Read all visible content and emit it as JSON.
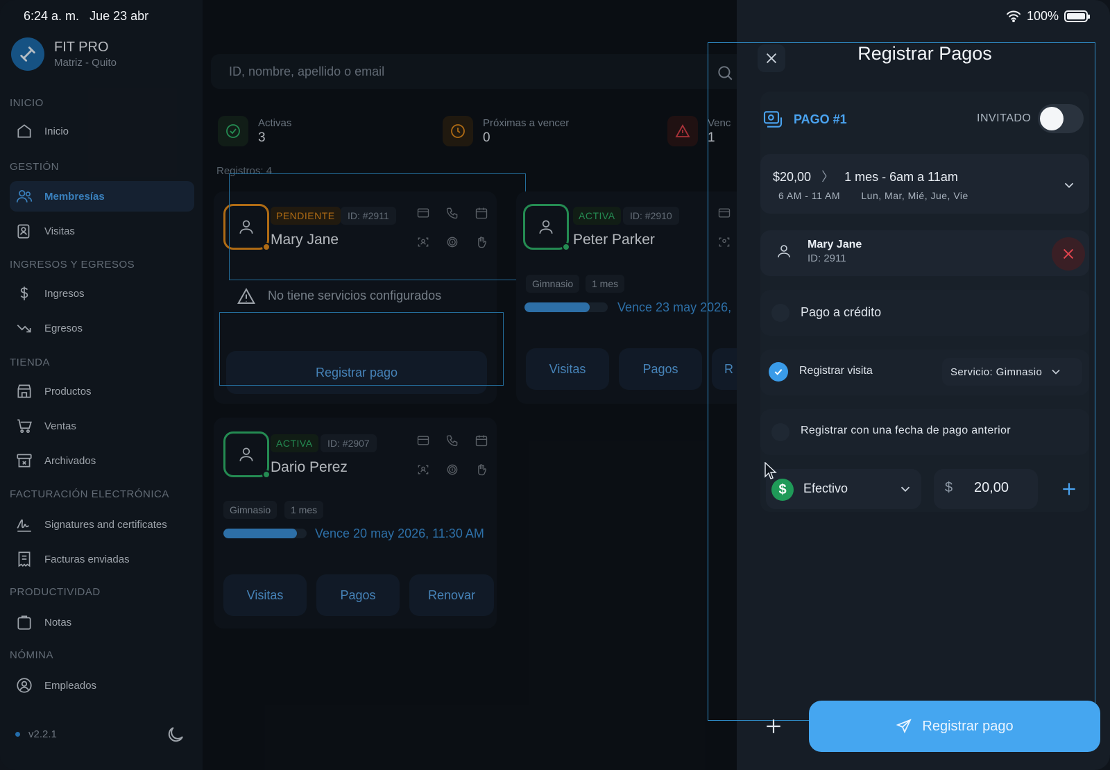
{
  "status_bar": {
    "time": "6:24 a. m.",
    "date": "Jue 23 abr",
    "battery": "100%"
  },
  "brand": {
    "name": "FIT PRO",
    "branch": "Matriz - Quito"
  },
  "sidebar": {
    "sections": [
      {
        "title": "INICIO"
      },
      {
        "title": "GESTIÓN"
      },
      {
        "title": "INGRESOS Y EGRESOS"
      },
      {
        "title": "TIENDA"
      },
      {
        "title": "FACTURACIÓN ELECTRÓNICA"
      },
      {
        "title": "PRODUCTIVIDAD"
      },
      {
        "title": "NÓMINA"
      }
    ],
    "items": [
      {
        "label": "Inicio",
        "icon": "home-icon"
      },
      {
        "label": "Membresías",
        "icon": "users-icon",
        "active": true
      },
      {
        "label": "Visitas",
        "icon": "clipboard-user-icon"
      },
      {
        "label": "Ingresos",
        "icon": "dollar-icon"
      },
      {
        "label": "Egresos",
        "icon": "trend-down-icon"
      },
      {
        "label": "Productos",
        "icon": "store-icon"
      },
      {
        "label": "Ventas",
        "icon": "cart-icon"
      },
      {
        "label": "Archivados",
        "icon": "archive-icon"
      },
      {
        "label": "Signatures and certificates",
        "icon": "signature-icon"
      },
      {
        "label": "Facturas enviadas",
        "icon": "invoice-icon"
      },
      {
        "label": "Notas",
        "icon": "notes-icon"
      },
      {
        "label": "Empleados",
        "icon": "employee-icon"
      }
    ],
    "version": "v2.2.1"
  },
  "search": {
    "placeholder": "ID, nombre, apellido o email"
  },
  "stats": [
    {
      "label": "Activas",
      "value": "3",
      "color": "#2fb36a"
    },
    {
      "label": "Próximas a vencer",
      "value": "0",
      "color": "#e08a1a"
    },
    {
      "label": "Venc",
      "value": "1",
      "color": "#d9414a"
    }
  ],
  "records_label": "Registros: 4",
  "cards": [
    {
      "status": "PENDIENTE",
      "id": "ID: #2911",
      "name": "Mary Jane",
      "warning": "No tiene servicios configurados",
      "action": "Registrar pago"
    },
    {
      "status": "ACTIVA",
      "id": "ID: #2910",
      "name": "Peter Parker",
      "service": "Gimnasio",
      "duration": "1 mes",
      "progress": 0.78,
      "expiry": "Vence 23 may 2026,",
      "actions": [
        "Visitas",
        "Pagos",
        "R"
      ]
    },
    {
      "status": "ACTIVA",
      "id": "ID: #2907",
      "name": "Dario Perez",
      "service": "Gimnasio",
      "duration": "1 mes",
      "progress": 0.88,
      "expiry": "Vence 20 may 2026, 11:30 AM",
      "actions": [
        "Visitas",
        "Pagos",
        "Renovar"
      ]
    }
  ],
  "panel": {
    "title": "Registrar Pagos",
    "payment_title": "PAGO #1",
    "guest_label": "INVITADO",
    "guest_enabled": false,
    "plan": {
      "price": "$20,00",
      "name": "1 mes - 6am a 11am",
      "hours": "6 AM - 11 AM",
      "days": "Lun, Mar, Mié, Jue, Vie"
    },
    "member": {
      "name": "Mary Jane",
      "id": "ID: 2911"
    },
    "credit_label": "Pago a crédito",
    "visit_label": "Registrar visita",
    "visit_checked": true,
    "service_select": "Servicio: Gimnasio",
    "previous_date_label": "Registrar con una fecha de pago anterior",
    "method": "Efectivo",
    "currency_symbol": "$",
    "amount": "20,00",
    "submit_label": "Registrar pago"
  },
  "colors": {
    "accent": "#45a6f0",
    "pending": "#e08a1a",
    "active": "#2fb36a",
    "danger": "#e0444e"
  }
}
